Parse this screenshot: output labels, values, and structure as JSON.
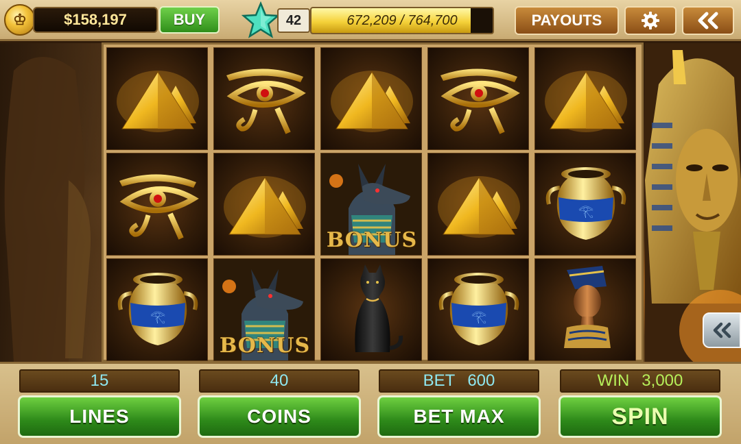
{
  "header": {
    "balance": "$158,197",
    "buy_label": "BUY",
    "level": "42",
    "xp_text": "672,209 / 764,700",
    "xp_progress": 0.879,
    "payouts_label": "PAYOUTS",
    "settings_icon": "gear-icon",
    "back_icon": "double-chevron-left-icon",
    "coin_symbol": "♔"
  },
  "reels": [
    [
      "pyramids",
      "eye-of-horus",
      "vase"
    ],
    [
      "eye-of-horus",
      "pyramids",
      "anubis-bonus"
    ],
    [
      "pyramids",
      "anubis-bonus",
      "black-cat"
    ],
    [
      "eye-of-horus",
      "pyramids",
      "vase"
    ],
    [
      "pyramids",
      "vase",
      "nefertiti-bust"
    ]
  ],
  "bonus_label": "BONUS",
  "side_button_icon": "double-chevron-left-icon",
  "controls": {
    "lines_value": "15",
    "lines_label": "LINES",
    "coins_value": "40",
    "coins_label": "COINS",
    "bet_caption": "BET",
    "bet_value": "600",
    "betmax_label": "BET MAX",
    "win_caption": "WIN",
    "win_value": "3,000",
    "spin_label": "SPIN"
  },
  "colors": {
    "accent_green": "#2f8e1a",
    "gold": "#f5d23a",
    "readout_cyan": "#8fe7f0",
    "win_green": "#b6ef5a"
  }
}
